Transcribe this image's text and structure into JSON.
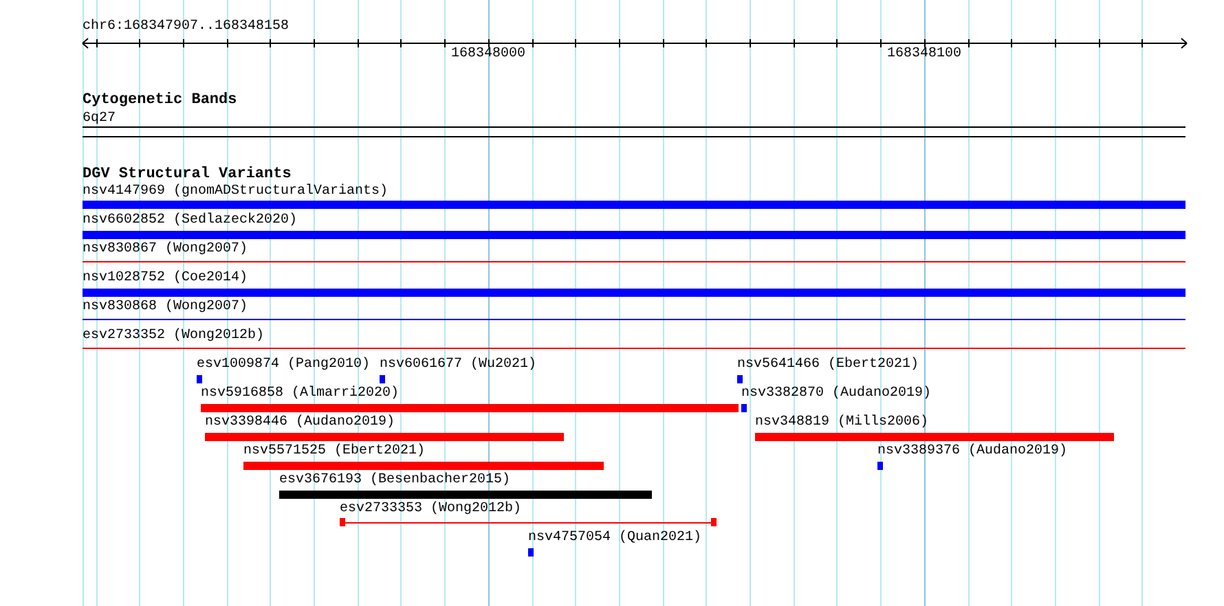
{
  "ruler": {
    "region": "chr6:168347907..168348158",
    "tick_labels": [
      "168348000",
      "168348100"
    ]
  },
  "tracks": [
    {
      "title": "Cytogenetic Bands",
      "features": [
        {
          "label": "6q27",
          "kind": "band",
          "color": "#000000"
        }
      ]
    },
    {
      "title": "DGV Structural Variants",
      "features": [
        {
          "label": "nsv4147969 (gnomADStructuralVariants)",
          "kind": "bar",
          "color": "#0000ff"
        },
        {
          "label": "nsv6602852 (Sedlazeck2020)",
          "kind": "bar",
          "color": "#0000ff"
        },
        {
          "label": "nsv830867 (Wong2007)",
          "kind": "line",
          "color": "#ff0000"
        },
        {
          "label": "nsv1028752 (Coe2014)",
          "kind": "bar",
          "color": "#0000ff"
        },
        {
          "label": "nsv830868 (Wong2007)",
          "kind": "line",
          "color": "#0000ff"
        },
        {
          "label": "esv2733352 (Wong2012b)",
          "kind": "line",
          "color": "#ff0000"
        },
        {
          "label": "esv1009874 (Pang2010)",
          "kind": "bar",
          "color": "#0000ff"
        },
        {
          "label": "nsv6061677 (Wu2021)",
          "kind": "bar",
          "color": "#0000ff"
        },
        {
          "label": "nsv5641466 (Ebert2021)",
          "kind": "bar",
          "color": "#0000ff"
        },
        {
          "label": "nsv5916858 (Almarri2020)",
          "kind": "bar",
          "color": "#ff0000"
        },
        {
          "label": "nsv3382870 (Audano2019)",
          "kind": "bar",
          "color": "#0000ff"
        },
        {
          "label": "nsv3398446 (Audano2019)",
          "kind": "bar",
          "color": "#ff0000"
        },
        {
          "label": "nsv348819 (Mills2006)",
          "kind": "bar",
          "color": "#ff0000"
        },
        {
          "label": "nsv5571525 (Ebert2021)",
          "kind": "bar",
          "color": "#ff0000"
        },
        {
          "label": "nsv3389376 (Audano2019)",
          "kind": "bar",
          "color": "#0000ff"
        },
        {
          "label": "esv3676193 (Besenbacher2015)",
          "kind": "bar",
          "color": "#000000"
        },
        {
          "label": "esv2733353 (Wong2012b)",
          "kind": "span",
          "color": "#ff0000"
        },
        {
          "label": "nsv4757054 (Quan2021)",
          "kind": "bar",
          "color": "#0000ff"
        }
      ]
    }
  ]
}
